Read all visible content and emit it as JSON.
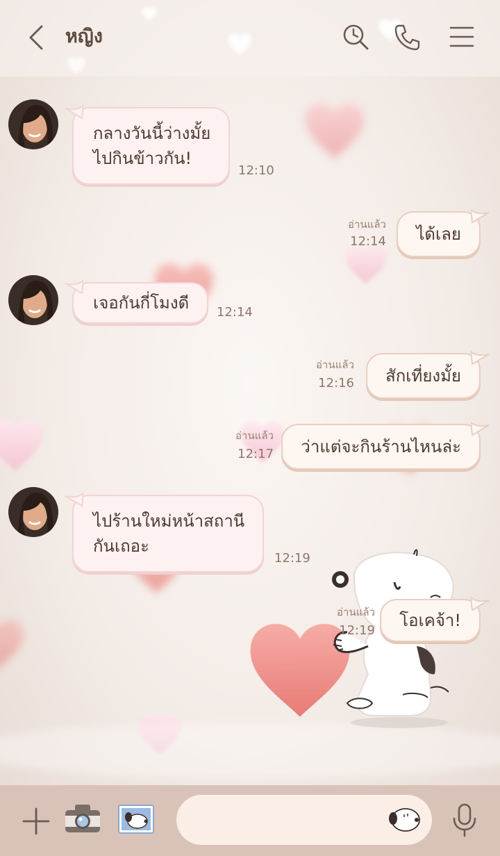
{
  "colors": {
    "background": "#f5ede8",
    "header_text": "#5e4a40",
    "bubble_in": "#fdf1f1",
    "bubble_out": "#fdf6f1",
    "footer": "#d9c3b9"
  },
  "header": {
    "title": "หญิง",
    "icons": [
      "chevron-left-icon",
      "search-icon",
      "phone-icon",
      "menu-icon"
    ]
  },
  "messages": [
    {
      "direction": "in",
      "lines": [
        "กลางวันนี้ว่างมั้ย",
        "ไปกินข้าวกัน!"
      ],
      "time": "12:10"
    },
    {
      "direction": "out",
      "text": "ได้เลย",
      "read": "อ่านแล้ว",
      "time": "12:14"
    },
    {
      "direction": "in",
      "text": "เจอกันกี่โมงดี",
      "time": "12:14"
    },
    {
      "direction": "out",
      "text": "สักเที่ยงมั้ย",
      "read": "อ่านแล้ว",
      "time": "12:16"
    },
    {
      "direction": "out",
      "text": "ว่าแต่จะกินร้านไหนล่ะ",
      "read": "อ่านแล้ว",
      "time": "12:17"
    },
    {
      "direction": "in",
      "lines": [
        "ไปร้านใหม่หน้าสถานี",
        "กันเถอะ"
      ],
      "time": "12:19"
    },
    {
      "direction": "out",
      "text": "โอเคจ้า!",
      "read": "อ่านแล้ว",
      "time": "12:19"
    }
  ],
  "footer": {
    "icons": [
      "plus-icon",
      "camera-icon",
      "gallery-icon",
      "sticker-icon",
      "microphone-icon"
    ],
    "input_value": ""
  }
}
